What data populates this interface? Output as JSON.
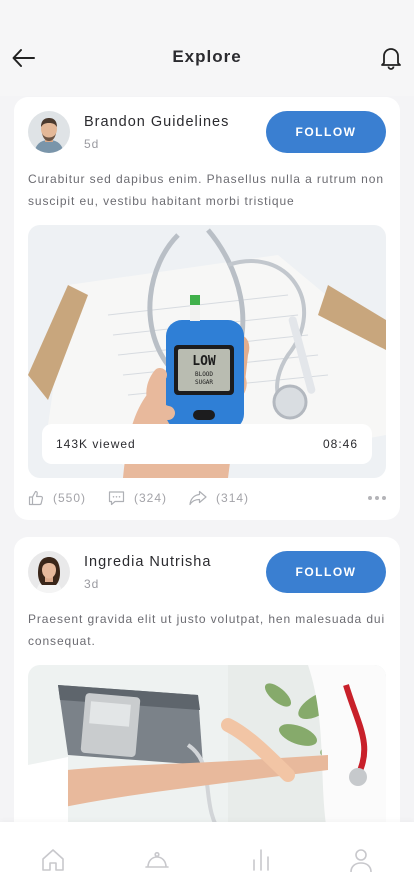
{
  "header": {
    "title": "Explore"
  },
  "posts": [
    {
      "author": "Brandon Guidelines",
      "age": "5d",
      "follow_label": "FOLLOW",
      "text": "Curabitur sed dapibus enim. Phasellus nulla a rutrum non suscipit eu, vestibu habitant morbi tristique",
      "media": {
        "views": "143K viewed",
        "duration": "08:46",
        "meter_text_1": "LOW",
        "meter_text_2": "BLOOD",
        "meter_text_3": "SUGAR"
      },
      "likes": "(550)",
      "comments": "(324)",
      "shares": "(314)"
    },
    {
      "author": "Ingredia Nutrisha",
      "age": "3d",
      "follow_label": "FOLLOW",
      "text": "Praesent gravida elit ut justo volutpat, hen malesuada dui consequat."
    }
  ],
  "tabs": [
    {
      "icon": "home-icon"
    },
    {
      "icon": "cloche-icon"
    },
    {
      "icon": "stats-icon"
    },
    {
      "icon": "profile-icon"
    }
  ],
  "colors": {
    "accent": "#3a7fd1",
    "background": "#f4f4f6"
  }
}
